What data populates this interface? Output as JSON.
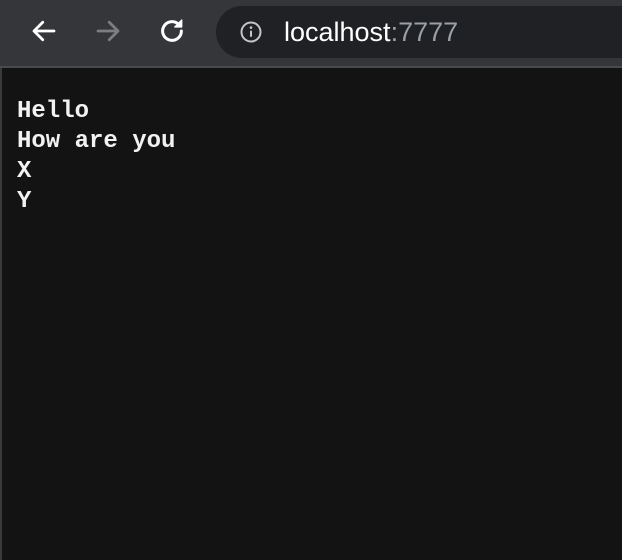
{
  "browser": {
    "url_host": "localhost",
    "url_port": ":7777",
    "icons": {
      "back": "arrow-left-icon",
      "forward": "arrow-right-icon",
      "reload": "reload-icon",
      "site_info": "info-circle-icon"
    },
    "colors": {
      "toolbar": "#35363a",
      "omnibox": "#202124",
      "page_background": "#131313",
      "text": "#f2f2f2",
      "muted": "#9aa0a6"
    }
  },
  "page": {
    "lines": [
      "Hello",
      "How are you",
      "X",
      "Y"
    ]
  }
}
